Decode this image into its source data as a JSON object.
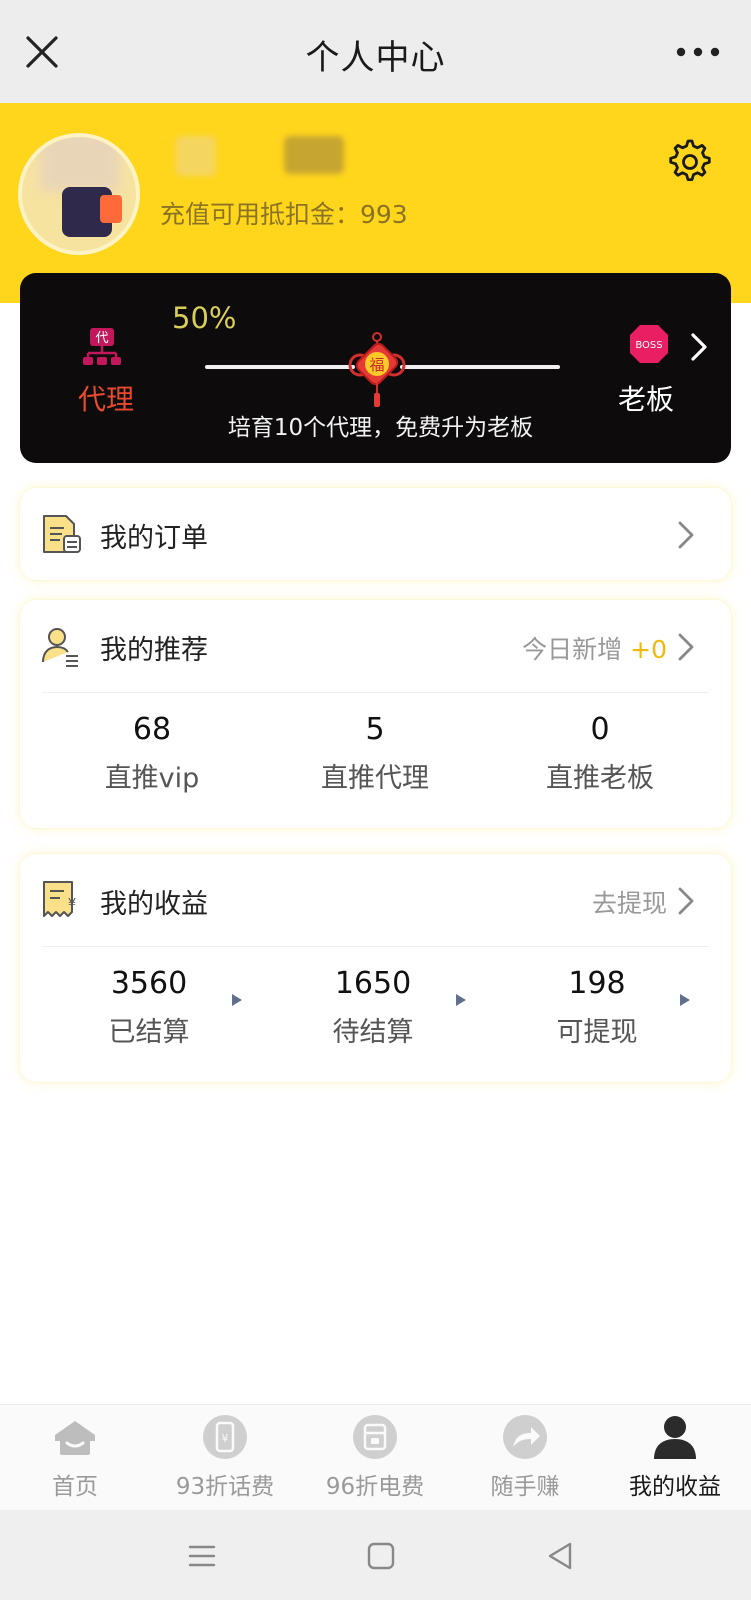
{
  "titlebar": {
    "title": "个人中心",
    "close_icon": "close-icon",
    "more_icon": "more-icon"
  },
  "profile": {
    "balance_text": "充值可用抵扣金：993",
    "settings_icon": "gear-icon"
  },
  "level": {
    "current_label": "代理",
    "current_icon": "agent-icon",
    "next_label": "老板",
    "next_icon_text": "BOSS",
    "progress_text": "50%",
    "progress": 0.5,
    "knot_text": "福",
    "hint": "培育10个代理，免费升为老板"
  },
  "orders": {
    "title": "我的订单"
  },
  "recommend": {
    "title": "我的推荐",
    "today_label": "今日新增",
    "today_value": "+0",
    "stats": [
      {
        "value": "68",
        "label": "直推vip"
      },
      {
        "value": "5",
        "label": "直推代理"
      },
      {
        "value": "0",
        "label": "直推老板"
      }
    ]
  },
  "earnings": {
    "title": "我的收益",
    "withdraw_label": "去提现",
    "stats": [
      {
        "value": "3560",
        "label": "已结算"
      },
      {
        "value": "1650",
        "label": "待结算"
      },
      {
        "value": "198",
        "label": "可提现"
      }
    ]
  },
  "tabs": [
    {
      "label": "首页",
      "icon": "home-icon"
    },
    {
      "label": "93折话费",
      "icon": "phone-icon"
    },
    {
      "label": "96折电费",
      "icon": "electricity-icon"
    },
    {
      "label": "随手赚",
      "icon": "share-icon"
    },
    {
      "label": "我的收益",
      "icon": "user-icon",
      "active": true
    }
  ],
  "colors": {
    "brand_yellow": "#ffd61c",
    "level_card_bg": "#0d0b0b",
    "agent_red": "#e84a2e",
    "accent_plus": "#f0b90b"
  }
}
